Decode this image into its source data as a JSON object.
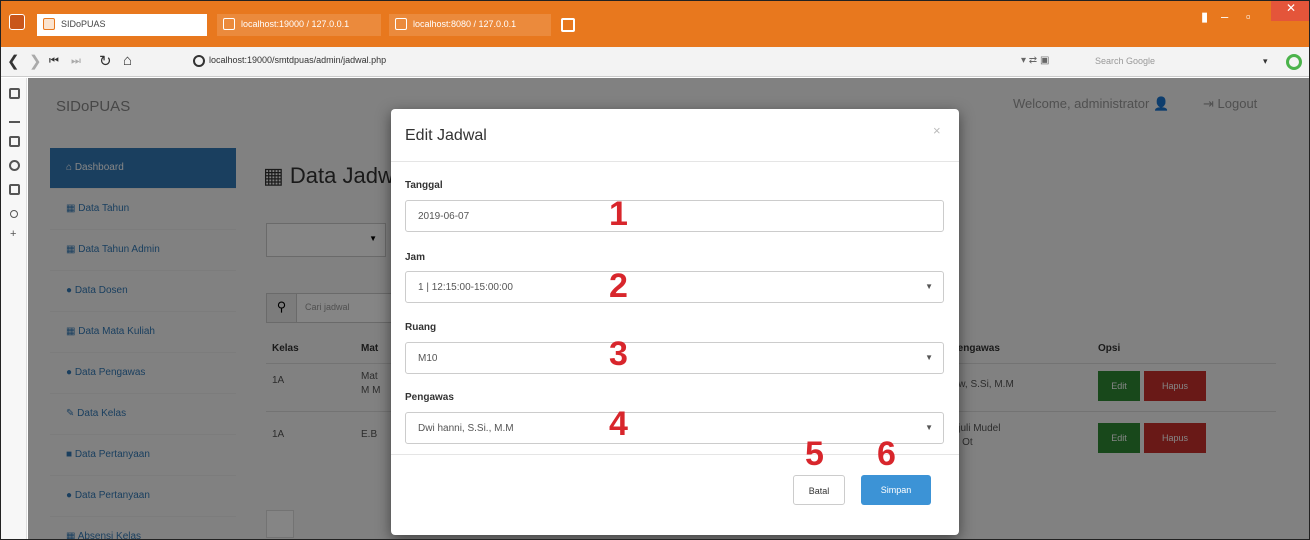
{
  "browser": {
    "tabs": [
      {
        "label": "SIDoPUAS"
      },
      {
        "label": "localhost:19000 / 127.0.0.1"
      },
      {
        "label": "localhost:8080 / 127.0.0.1"
      }
    ],
    "url": "localhost:19000/smtdpuas/admin/jadwal.php",
    "search_placeholder": "Search Google",
    "accent_color": "#e8781e"
  },
  "app": {
    "brand": "SIDoPUAS",
    "user_label": "Welcome, administrator",
    "logout_label": "Logout"
  },
  "sidebar": {
    "items": [
      {
        "label": "Dashboard",
        "active": true
      },
      {
        "label": "Data Tahun"
      },
      {
        "label": "Data Tahun Admin"
      },
      {
        "label": "Data Dosen"
      },
      {
        "label": "Data Mata Kuliah"
      },
      {
        "label": "Data Pengawas"
      },
      {
        "label": "Data Kelas"
      },
      {
        "label": "Data Pertanyaan"
      },
      {
        "label": "Data Pertanyaan"
      },
      {
        "label": "Absensi Kelas"
      }
    ]
  },
  "main": {
    "title": "Data Jadwal",
    "search_placeholder": "Cari jadwal",
    "table": {
      "headers": [
        "Kelas",
        "Mat",
        "Pengawas",
        "Opsi"
      ],
      "rows": [
        {
          "kelas": "1A",
          "mat": "Mat",
          "mat2": "M M",
          "pengawas": "Dw, S.Si, M.M"
        },
        {
          "kelas": "1A",
          "mat": "E.B",
          "pengawas": "Djuli Mudel",
          "pengawas2": "M Ot"
        }
      ],
      "edit_label": "Edit",
      "delete_label": "Hapus"
    }
  },
  "modal": {
    "title": "Edit Jadwal",
    "close_symbol": "×",
    "fields": [
      {
        "label": "Tanggal",
        "value": "2019-06-07",
        "number": "1"
      },
      {
        "label": "Jam",
        "value": "1 | 12:15:00-15:00:00",
        "number": "2"
      },
      {
        "label": "Ruang",
        "value": "M10",
        "number": "3"
      },
      {
        "label": "Pengawas",
        "value": "Dwi hanni, S.Si., M.M",
        "number": "4"
      }
    ],
    "cancel_label": "Batal",
    "cancel_number": "5",
    "save_label": "Simpan",
    "save_number": "6"
  }
}
